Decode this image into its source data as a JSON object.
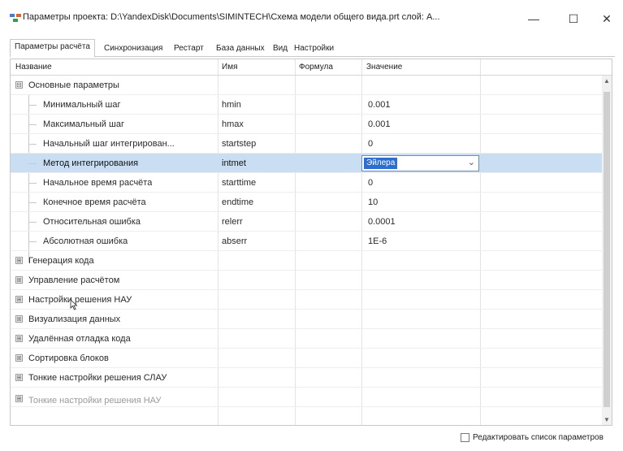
{
  "window": {
    "title": "Параметры проекта: D:\\YandexDisk\\Documents\\SIMINTECH\\Схема модели общего вида.prt слой: А...",
    "minimize": "—",
    "maximize": "☐",
    "close": "✕"
  },
  "tabs": [
    {
      "label": "Параметры расчёта",
      "active": true
    },
    {
      "label": "Синхронизация",
      "active": false
    },
    {
      "label": "Рестарт",
      "active": false
    },
    {
      "label": "База данных",
      "active": false
    },
    {
      "label": "Вид",
      "active": false
    },
    {
      "label": "Настройки",
      "active": false
    }
  ],
  "columns": {
    "name": "Название",
    "id": "Имя",
    "formula": "Формула",
    "value": "Значение"
  },
  "groups": {
    "basic": {
      "label": "Основные параметры",
      "expanded": true
    },
    "collapsed": [
      "Генерация кода",
      "Управление расчётом",
      "Настройки решения НАУ",
      "Визуализация данных",
      "Удалённая отладка кода",
      "Сортировка блоков",
      "Тонкие настройки решения СЛАУ",
      "Тонкие настройки решения НАУ"
    ]
  },
  "params": [
    {
      "label": "Минимальный шаг",
      "id": "hmin",
      "value": "0.001"
    },
    {
      "label": "Максимальный шаг",
      "id": "hmax",
      "value": "0.001"
    },
    {
      "label": "Начальный шаг интегрирован...",
      "id": "startstep",
      "value": "0"
    },
    {
      "label": "Метод интегрирования",
      "id": "intmet",
      "value": "Эйлера",
      "selected": true
    },
    {
      "label": "Начальное время расчёта",
      "id": "starttime",
      "value": "0"
    },
    {
      "label": "Конечное время расчёта",
      "id": "endtime",
      "value": "10"
    },
    {
      "label": "Относительная ошибка",
      "id": "relerr",
      "value": "0.0001"
    },
    {
      "label": "Абсолютная ошибка",
      "id": "abserr",
      "value": "1E-6"
    }
  ],
  "footer": {
    "edit_params_label": "Редактировать список параметров",
    "edit_params_checked": false
  },
  "colors": {
    "selection": "#c9def3",
    "combo_highlight": "#2a6fd1",
    "grid_lines": "#e3e3e3"
  },
  "icons": {
    "expand": "⊞",
    "collapse": "⊟",
    "dropdown": "⌄",
    "scroll_up": "▲",
    "scroll_down": "▼"
  }
}
